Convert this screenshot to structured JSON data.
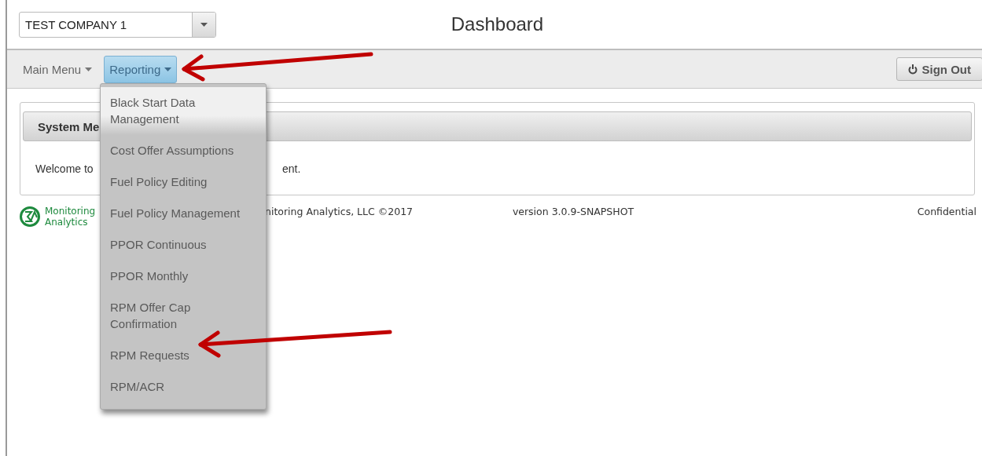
{
  "company_select": {
    "value": "TEST COMPANY 1"
  },
  "page_title": "Dashboard",
  "nav": {
    "items": [
      {
        "label": "Main Menu",
        "selected": false
      },
      {
        "label": "Reporting",
        "selected": true
      }
    ],
    "sign_out": "Sign Out"
  },
  "panel": {
    "title": "System Me",
    "welcome_left": "Welcome to",
    "welcome_right": "ent."
  },
  "reporting_menu": [
    {
      "label": "Black Start Data Management",
      "selected": true
    },
    {
      "label": "Cost Offer Assumptions",
      "selected": false
    },
    {
      "label": "Fuel Policy Editing",
      "selected": false
    },
    {
      "label": "Fuel Policy Management",
      "selected": false
    },
    {
      "label": "PPOR Continuous",
      "selected": false
    },
    {
      "label": "PPOR Monthly",
      "selected": false
    },
    {
      "label": "RPM Offer Cap Confirmation",
      "selected": false
    },
    {
      "label": "RPM Requests",
      "selected": false
    },
    {
      "label": "RPM/ACR",
      "selected": false
    }
  ],
  "footer": {
    "logo_line_1": "Monitoring",
    "logo_line_2": "Analytics",
    "copyright": "nitoring Analytics, LLC ©2017",
    "version": "version 3.0.9-SNAPSHOT",
    "notice": "Confidential"
  }
}
